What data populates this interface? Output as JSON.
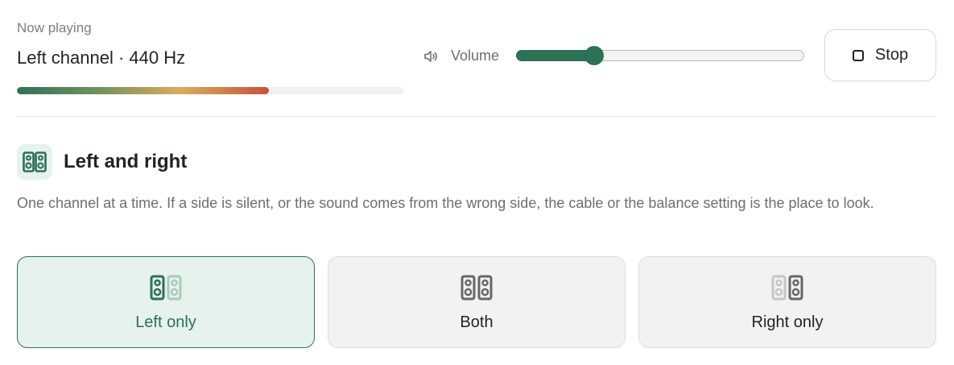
{
  "now_playing": {
    "label": "Now playing",
    "title": "Left channel · 440 Hz",
    "progress": 0.65
  },
  "volume": {
    "label": "Volume",
    "level": 0.27,
    "icon": "speaker-icon"
  },
  "stop_button": {
    "label": "Stop",
    "icon": "stop-icon"
  },
  "section": {
    "icon": "speakers-icon",
    "title": "Left and right",
    "description": "One channel at a time. If a side is silent, or the sound comes from the wrong side, the cable or the balance setting is the place to look."
  },
  "options": [
    {
      "label": "Left only",
      "selected": true,
      "icon": "left-speaker-icon"
    },
    {
      "label": "Both",
      "selected": false,
      "icon": "both-speakers-icon"
    },
    {
      "label": "Right only",
      "selected": false,
      "icon": "right-speaker-icon"
    }
  ],
  "colors": {
    "accent": "#2d7156",
    "accent_bg": "#e6f2ec",
    "progress_gradient": [
      "#2f7258",
      "#d9ac5c",
      "#c8523c"
    ]
  }
}
